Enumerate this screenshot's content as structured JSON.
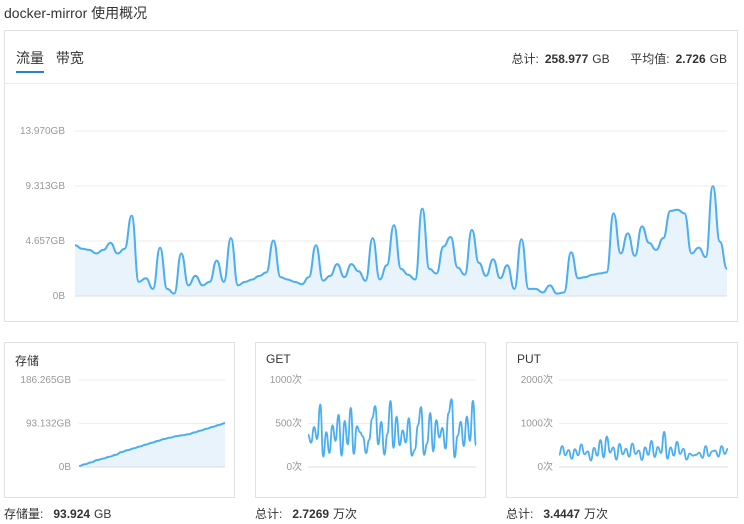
{
  "page": {
    "title": "docker-mirror 使用概况"
  },
  "main": {
    "tabs": [
      {
        "label": "流量",
        "active": true
      },
      {
        "label": "带宽",
        "active": false
      }
    ],
    "total_label": "总计:",
    "total_value": "258.977",
    "total_unit": "GB",
    "avg_label": "平均值:",
    "avg_value": "2.726",
    "avg_unit": "GB"
  },
  "storage": {
    "title": "存储",
    "footer_label": "存储量:",
    "footer_value": "93.924",
    "footer_unit": "GB"
  },
  "get": {
    "title": "GET",
    "footer_label": "总计:",
    "footer_value": "2.7269",
    "footer_unit": "万次"
  },
  "put": {
    "title": "PUT",
    "footer_label": "总计:",
    "footer_value": "3.4447",
    "footer_unit": "万次"
  },
  "colors": {
    "line": "#4aaef0",
    "fill": "#e8f3fc",
    "grid": "#eeeeee",
    "tab_active": "#2a7ed3"
  },
  "chart_data": [
    {
      "type": "area",
      "name": "traffic",
      "yticks": [
        "0B",
        "4.657GB",
        "9.313GB",
        "13.970GB"
      ],
      "ylim": [
        0,
        13.97
      ],
      "values": [
        4.3,
        4.0,
        3.9,
        3.6,
        3.9,
        4.5,
        3.6,
        4.0,
        6.8,
        1.2,
        1.5,
        0.6,
        4.1,
        0.6,
        0.2,
        3.6,
        0.9,
        1.7,
        0.9,
        1.2,
        3.0,
        1.2,
        4.9,
        0.9,
        1.2,
        1.4,
        1.7,
        2.0,
        4.7,
        1.6,
        1.4,
        1.2,
        1.0,
        1.6,
        4.3,
        1.3,
        1.7,
        2.7,
        1.6,
        2.7,
        2.1,
        1.3,
        4.9,
        1.4,
        2.6,
        6.0,
        2.3,
        1.8,
        1.4,
        7.4,
        2.3,
        1.9,
        4.2,
        5.0,
        2.4,
        1.8,
        5.6,
        2.8,
        1.7,
        3.1,
        1.5,
        2.6,
        0.6,
        4.8,
        0.6,
        0.6,
        0.3,
        0.9,
        0.2,
        0.3,
        3.7,
        1.5,
        1.6,
        1.8,
        1.9,
        2.0,
        7.0,
        3.6,
        5.3,
        3.4,
        5.9,
        4.5,
        3.9,
        4.9,
        7.2,
        7.3,
        7.0,
        3.6,
        4.1,
        3.3,
        9.3,
        4.6,
        2.3
      ]
    },
    {
      "type": "area",
      "name": "storage",
      "yticks": [
        "0B",
        "93.132GB",
        "186.265GB"
      ],
      "ylim": [
        0,
        186.265
      ],
      "values": [
        2,
        6,
        10,
        15,
        18,
        22,
        26,
        32,
        36,
        40,
        44,
        48,
        52,
        56,
        60,
        63,
        66,
        68,
        70,
        74,
        78,
        82,
        86,
        90,
        94
      ]
    },
    {
      "type": "line",
      "name": "get",
      "yticks": [
        "0次",
        "500次",
        "1000次"
      ],
      "ylim": [
        0,
        1000
      ],
      "values": [
        370,
        280,
        460,
        320,
        720,
        120,
        400,
        160,
        480,
        300,
        600,
        130,
        530,
        260,
        680,
        150,
        470,
        400,
        350,
        160,
        310,
        560,
        700,
        260,
        520,
        140,
        380,
        760,
        220,
        580,
        250,
        420,
        280,
        560,
        130,
        200,
        480,
        690,
        140,
        270,
        620,
        180,
        540,
        340,
        450,
        210,
        620,
        780,
        110,
        360,
        520,
        240,
        580,
        300,
        760,
        250
      ]
    },
    {
      "type": "line",
      "name": "put",
      "yticks": [
        "0次",
        "1000次",
        "2000次"
      ],
      "ylim": [
        0,
        2000
      ],
      "values": [
        280,
        480,
        270,
        390,
        190,
        410,
        270,
        520,
        290,
        360,
        150,
        440,
        260,
        620,
        220,
        700,
        330,
        450,
        170,
        530,
        290,
        420,
        240,
        540,
        300,
        380,
        160,
        450,
        280,
        600,
        230,
        460,
        320,
        810,
        190,
        450,
        260,
        580,
        300,
        420,
        170,
        310,
        260,
        280,
        330,
        210,
        480,
        250,
        360,
        380,
        240,
        480,
        300,
        420
      ]
    }
  ]
}
